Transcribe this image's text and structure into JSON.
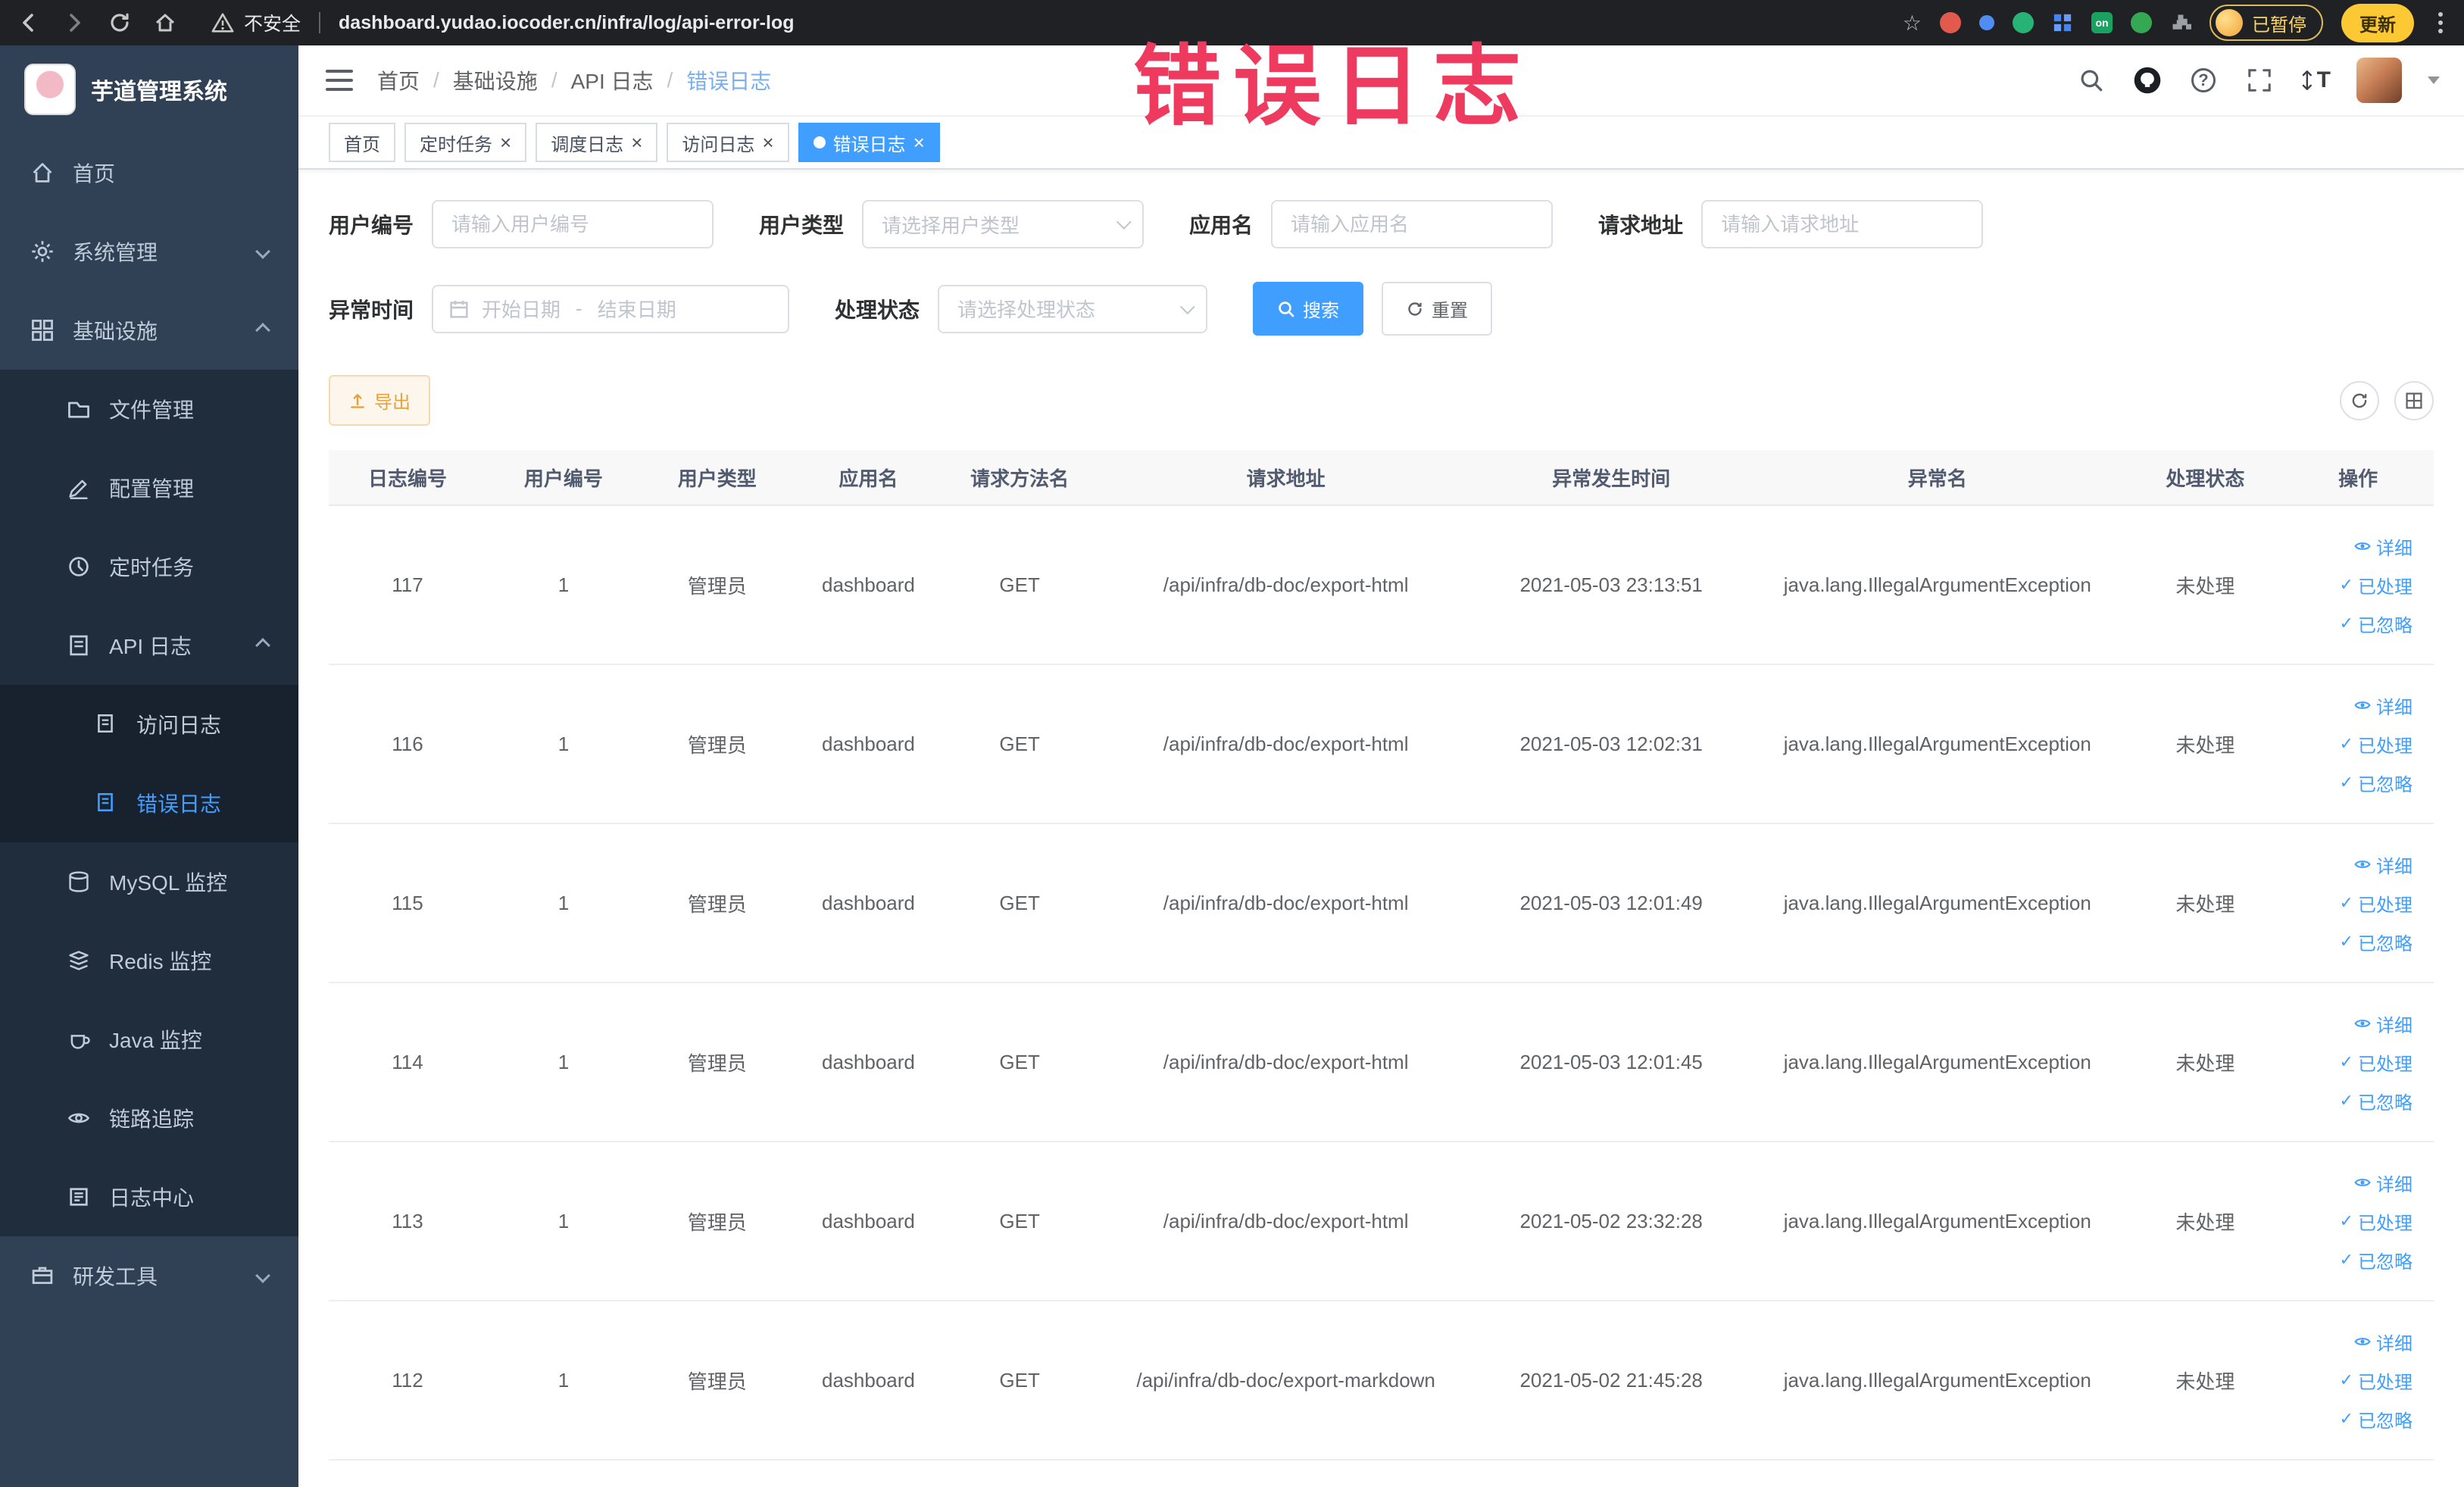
{
  "colors": {
    "accent": "#409eff",
    "sidebar_bg": "#304156",
    "sidebar_submenu_bg": "#1f2d3d",
    "sidebar_active_text": "#409eff",
    "warning_button": "#e6a23c",
    "watermark": "#ee3a5f",
    "chrome_bg": "#202124"
  },
  "watermark": {
    "text": "错误日志"
  },
  "browser": {
    "security_label": "不安全",
    "url": "dashboard.yudao.iocoder.cn/infra/log/api-error-log",
    "extension_on_badge": "on",
    "paused_badge": "已暂停",
    "update_button": "更新"
  },
  "sidebar": {
    "logo_title": "芋道管理系统",
    "items": [
      {
        "label": "首页"
      },
      {
        "label": "系统管理"
      },
      {
        "label": "基础设施"
      },
      {
        "label": "文件管理"
      },
      {
        "label": "配置管理"
      },
      {
        "label": "定时任务"
      },
      {
        "label": "API 日志"
      },
      {
        "label": "访问日志"
      },
      {
        "label": "错误日志"
      },
      {
        "label": "MySQL 监控"
      },
      {
        "label": "Redis 监控"
      },
      {
        "label": "Java 监控"
      },
      {
        "label": "链路追踪"
      },
      {
        "label": "日志中心"
      },
      {
        "label": "研发工具"
      }
    ]
  },
  "header": {
    "breadcrumbs": [
      "首页",
      "基础设施",
      "API 日志",
      "错误日志"
    ],
    "breadcrumb_separator": "/"
  },
  "tabs": [
    {
      "label": "首页"
    },
    {
      "label": "定时任务"
    },
    {
      "label": "调度日志"
    },
    {
      "label": "访问日志"
    },
    {
      "label": "错误日志"
    }
  ],
  "filters": {
    "user_id": {
      "label": "用户编号",
      "placeholder": "请输入用户编号"
    },
    "user_type": {
      "label": "用户类型",
      "placeholder": "请选择用户类型"
    },
    "app_name": {
      "label": "应用名",
      "placeholder": "请输入应用名"
    },
    "request_url": {
      "label": "请求地址",
      "placeholder": "请输入请求地址"
    },
    "exception_time": {
      "label": "异常时间",
      "start_placeholder": "开始日期",
      "separator": "-",
      "end_placeholder": "结束日期"
    },
    "process_status": {
      "label": "处理状态",
      "placeholder": "请选择处理状态"
    },
    "search_button": "搜索",
    "reset_button": "重置"
  },
  "toolbar": {
    "export_button": "导出"
  },
  "table": {
    "columns": [
      "日志编号",
      "用户编号",
      "用户类型",
      "应用名",
      "请求方法名",
      "请求地址",
      "异常发生时间",
      "异常名",
      "处理状态",
      "操作"
    ],
    "actions": [
      "详细",
      "已处理",
      "已忽略"
    ],
    "rows": [
      {
        "id": "117",
        "user_id": "1",
        "user_type": "管理员",
        "app": "dashboard",
        "method": "GET",
        "url": "/api/infra/db-doc/export-html",
        "time": "2021-05-03 23:13:51",
        "exception": "java.lang.IllegalArgumentException",
        "status": "未处理"
      },
      {
        "id": "116",
        "user_id": "1",
        "user_type": "管理员",
        "app": "dashboard",
        "method": "GET",
        "url": "/api/infra/db-doc/export-html",
        "time": "2021-05-03 12:02:31",
        "exception": "java.lang.IllegalArgumentException",
        "status": "未处理"
      },
      {
        "id": "115",
        "user_id": "1",
        "user_type": "管理员",
        "app": "dashboard",
        "method": "GET",
        "url": "/api/infra/db-doc/export-html",
        "time": "2021-05-03 12:01:49",
        "exception": "java.lang.IllegalArgumentException",
        "status": "未处理"
      },
      {
        "id": "114",
        "user_id": "1",
        "user_type": "管理员",
        "app": "dashboard",
        "method": "GET",
        "url": "/api/infra/db-doc/export-html",
        "time": "2021-05-03 12:01:45",
        "exception": "java.lang.IllegalArgumentException",
        "status": "未处理"
      },
      {
        "id": "113",
        "user_id": "1",
        "user_type": "管理员",
        "app": "dashboard",
        "method": "GET",
        "url": "/api/infra/db-doc/export-html",
        "time": "2021-05-02 23:32:28",
        "exception": "java.lang.IllegalArgumentException",
        "status": "未处理"
      },
      {
        "id": "112",
        "user_id": "1",
        "user_type": "管理员",
        "app": "dashboard",
        "method": "GET",
        "url": "/api/infra/db-doc/export-markdown",
        "time": "2021-05-02 21:45:28",
        "exception": "java.lang.IllegalArgumentException",
        "status": "未处理"
      }
    ]
  }
}
